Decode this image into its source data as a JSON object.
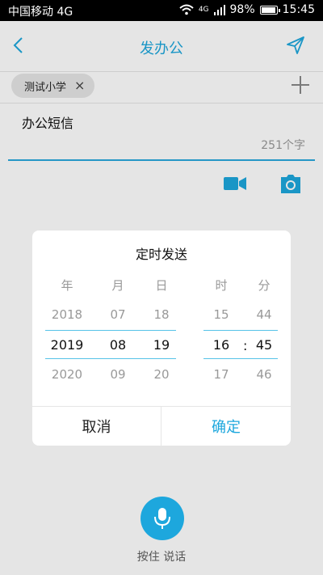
{
  "statusbar": {
    "carrier": "中国移动 4G",
    "signal_label": "4G",
    "battery": "98%",
    "time": "15:45"
  },
  "header": {
    "title": "发办公",
    "back_icon": "back-arrow-icon",
    "send_icon": "send-icon"
  },
  "recipients": [
    {
      "name": "测试小学",
      "remove": "×"
    }
  ],
  "compose": {
    "message": "办公短信",
    "count": "251个字"
  },
  "dialog": {
    "title": "定时发送",
    "headers": {
      "year": "年",
      "month": "月",
      "day": "日",
      "hour": "时",
      "minute": "分"
    },
    "rows": [
      {
        "year": "2018",
        "month": "07",
        "day": "18",
        "hour": "15",
        "minute": "44"
      },
      {
        "year": "2019",
        "month": "08",
        "day": "19",
        "hour": "16",
        "minute": "45"
      },
      {
        "year": "2020",
        "month": "09",
        "day": "20",
        "hour": "17",
        "minute": "46"
      }
    ],
    "colon": ":",
    "cancel": "取消",
    "confirm": "确定"
  },
  "voice": {
    "label": "按住 说话"
  },
  "colors": {
    "accent": "#1da7dd"
  }
}
